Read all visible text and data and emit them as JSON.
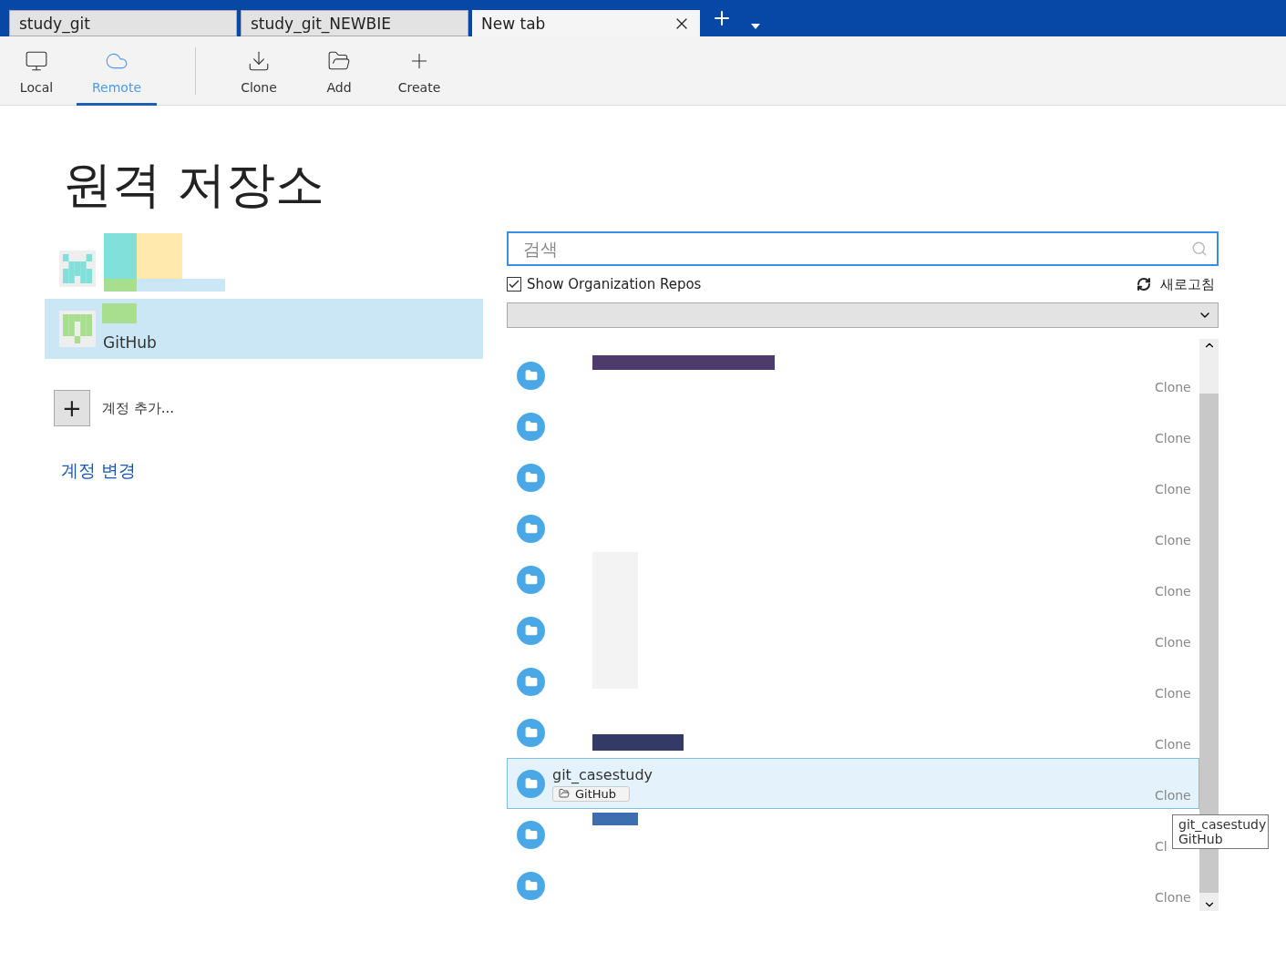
{
  "tabs": [
    {
      "label": "study_git",
      "selected": false
    },
    {
      "label": "study_git_NEWBIE",
      "selected": false
    },
    {
      "label": "New tab",
      "selected": true
    }
  ],
  "toolbar": [
    {
      "label": "Local",
      "selected": false
    },
    {
      "label": "Remote",
      "selected": true
    },
    {
      "label": "Clone",
      "selected": false
    },
    {
      "label": "Add",
      "selected": false
    },
    {
      "label": "Create",
      "selected": false
    }
  ],
  "title": "원격 저장소",
  "accounts": [
    {
      "selected": false,
      "color": "#82e0da"
    },
    {
      "service": "GitHub",
      "selected": true,
      "color": "#a8df8e"
    }
  ],
  "add_account": {
    "button": "+",
    "label": "계정 추가..."
  },
  "change_account": "계정 변경",
  "search": {
    "placeholder": "검색"
  },
  "show_org": {
    "label": "Show Organization Repos",
    "checked": true
  },
  "refresh": "새로고침",
  "repos": [
    {
      "action": "Clone",
      "selected": false
    },
    {
      "action": "Clone",
      "selected": false
    },
    {
      "action": "Clone",
      "selected": false
    },
    {
      "action": "Clone",
      "selected": false
    },
    {
      "action": "Clone",
      "selected": false
    },
    {
      "action": "Clone",
      "selected": false
    },
    {
      "action": "Clone",
      "selected": false
    },
    {
      "action": "Clone",
      "selected": false
    },
    {
      "name": "git_casestudy",
      "tag": "GitHub",
      "action": "Clone",
      "selected": true
    },
    {
      "action": "Cl",
      "selected": false
    },
    {
      "action": "Clone",
      "selected": false
    }
  ],
  "tooltip": {
    "lines": [
      "git_casestudy",
      "GitHub"
    ]
  }
}
